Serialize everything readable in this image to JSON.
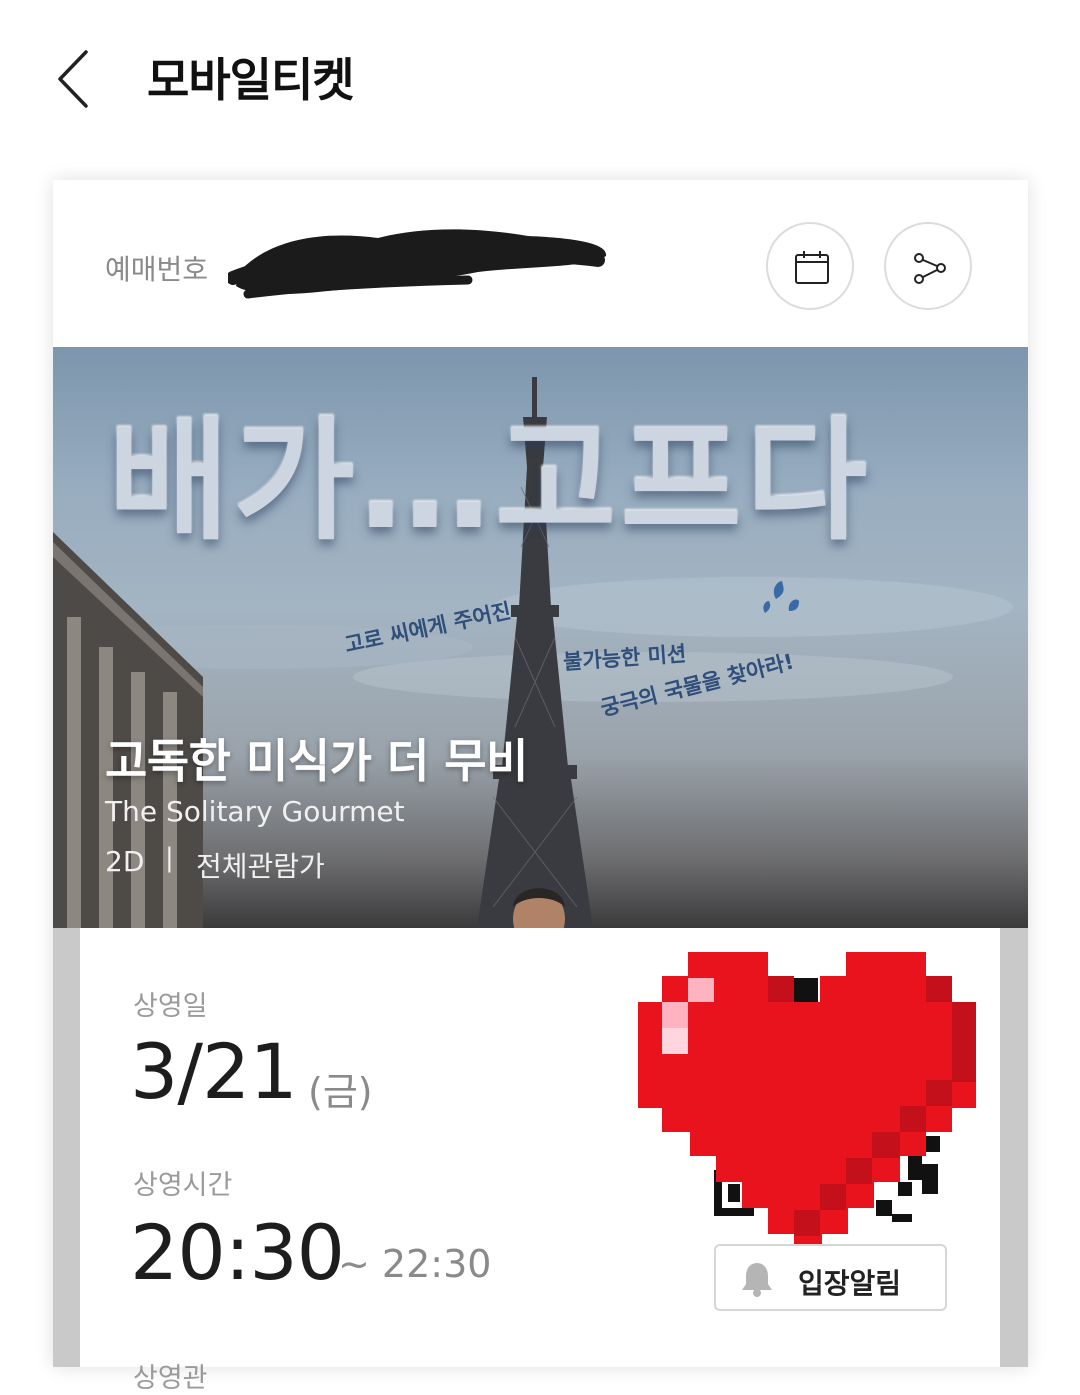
{
  "header": {
    "title": "모바일티켓",
    "back_icon": "chevron-left-icon"
  },
  "booking": {
    "label": "예매번호",
    "calendar_icon": "calendar-icon",
    "share_icon": "share-icon"
  },
  "poster": {
    "headline": "배가…고프다",
    "tagline_1": "고로 씨에게 주어진",
    "tagline_2": "불가능한 미션",
    "tagline_3": "궁극의 국물을 찾아라!"
  },
  "movie": {
    "title": "고독한 미식가 더 무비",
    "subtitle": "The Solitary Gourmet",
    "format": "2D",
    "separator": "|",
    "rating": "전체관람가"
  },
  "screening": {
    "date_label": "상영일",
    "date": "3/21",
    "weekday": "(금)",
    "time_label": "상영시간",
    "start_time": "20:30",
    "end_time": "~ 22:30",
    "next_label": "상영관"
  },
  "notify": {
    "label": "입장알림",
    "icon": "bell-icon"
  },
  "colors": {
    "heart_red": "#e8131d",
    "heart_dark": "#c3101a",
    "heart_highlight": "#ffb3c1"
  }
}
